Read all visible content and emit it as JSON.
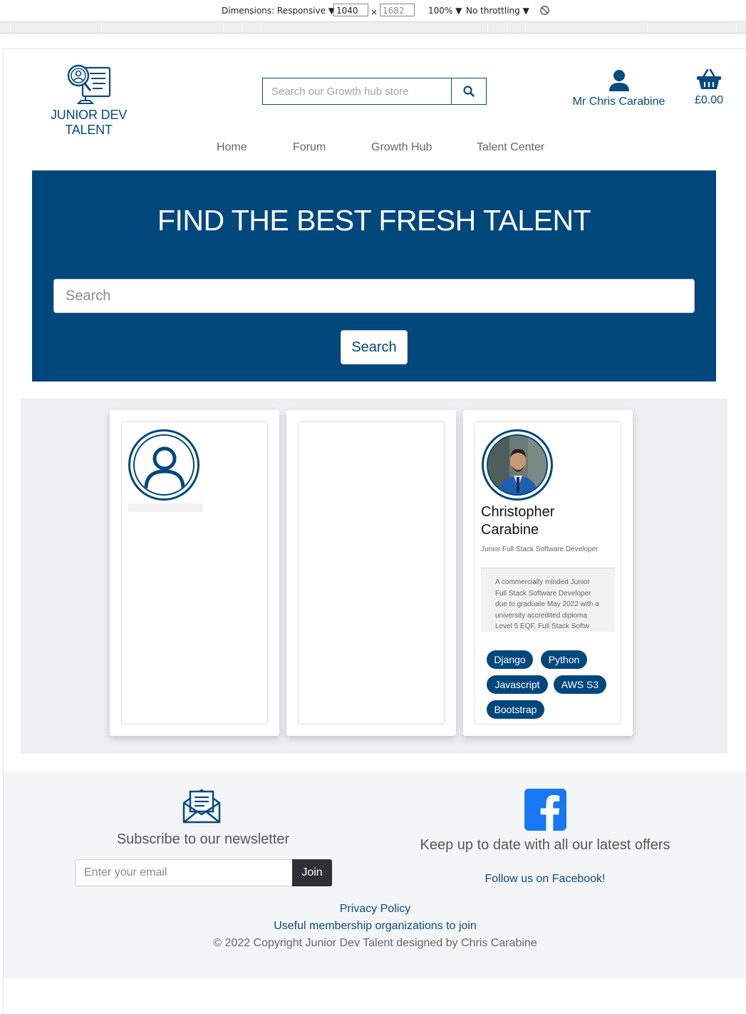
{
  "devtools": {
    "dimensions_label": "Dimensions: Responsive ▼",
    "width_value": "1040",
    "times_sign": "×",
    "height_value": "1682",
    "zoom_label": "100% ▼",
    "throttling_label": "No throttling ▼",
    "rotate_icon": "rotate-icon"
  },
  "header": {
    "logo_text": "JUNIOR DEV TALENT",
    "search_placeholder": "Search our Growth hub store",
    "account_name": "Mr Chris Carabine",
    "basket_total": "£0.00"
  },
  "nav": {
    "items": [
      "Home",
      "Forum",
      "Growth Hub",
      "Talent Center"
    ]
  },
  "hero": {
    "title": "FIND THE BEST FRESH TALENT",
    "search_placeholder": "Search",
    "search_button": "Search"
  },
  "profile": {
    "name": "Christopher Carabine",
    "role": "Junior Full Stack Software Developer",
    "bio": "A commercially minded Junior Full Stack Software Developer due to graduate May 2022 with a university accredited diploma Level 5 EQF, Full Stack Softw",
    "skills": [
      "Django",
      "Python",
      "Javascript",
      "AWS S3",
      "Bootstrap"
    ]
  },
  "footer": {
    "newsletter_title": "Subscribe to our newsletter",
    "email_placeholder": "Enter your email",
    "join_button": "Join",
    "social_title": "Keep up to date with all our latest offers",
    "facebook_link": "Follow us on Facebook!",
    "privacy_link": "Privacy Policy",
    "membership_link": "Useful membership organizations to join",
    "copyright": "© 2022 Copyright Junior Dev Talent designed by Chris Carabine"
  },
  "colors": {
    "brand_blue": "#00477c",
    "footer_bg": "#f4f5f6",
    "facebook_blue": "#1877f2",
    "join_button_bg": "#2d3134"
  }
}
